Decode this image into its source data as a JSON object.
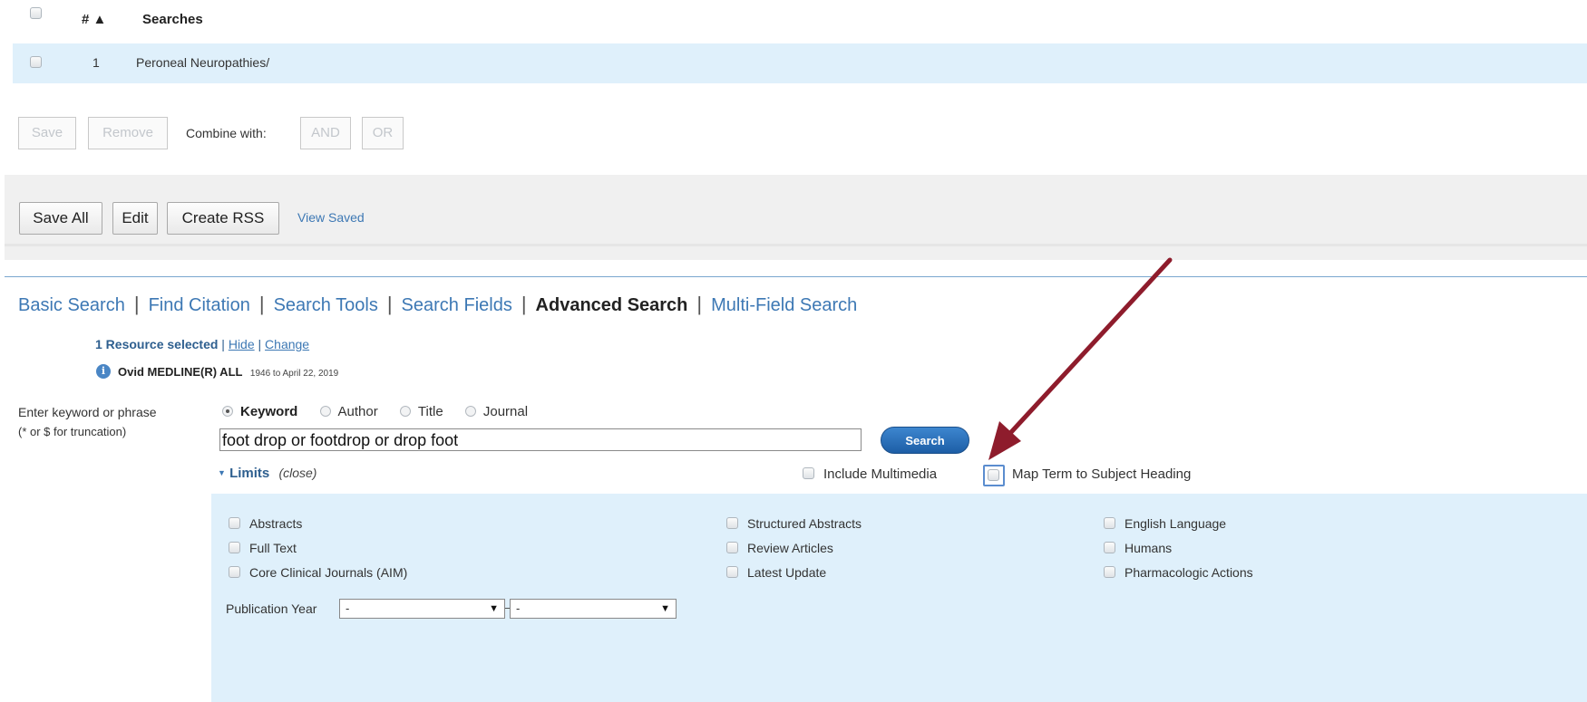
{
  "history": {
    "col_number": "# ▲",
    "col_searches": "Searches",
    "rows": [
      {
        "number": "1",
        "search": "Peroneal Neuropathies/"
      }
    ]
  },
  "actions": {
    "save": "Save",
    "remove": "Remove",
    "combine_label": "Combine with:",
    "and": "AND",
    "or": "OR"
  },
  "toolbar": {
    "save_all": "Save All",
    "edit": "Edit",
    "create_rss": "Create RSS",
    "view_saved": "View Saved"
  },
  "tabs": [
    {
      "label": "Basic Search",
      "active": false
    },
    {
      "label": "Find Citation",
      "active": false
    },
    {
      "label": "Search Tools",
      "active": false
    },
    {
      "label": "Search Fields",
      "active": false
    },
    {
      "label": "Advanced Search",
      "active": true
    },
    {
      "label": "Multi-Field Search",
      "active": false
    }
  ],
  "resource": {
    "selected": "1 Resource selected",
    "divider": "|",
    "hide": "Hide",
    "change": "Change",
    "db_name": "Ovid MEDLINE(R) ALL",
    "db_range": "1946 to April 22, 2019",
    "info_icon": "info-icon"
  },
  "search_form": {
    "prompt": "Enter keyword or phrase",
    "hint": "(* or $ for truncation)",
    "radio_options": [
      {
        "label": "Keyword",
        "checked": true
      },
      {
        "label": "Author",
        "checked": false
      },
      {
        "label": "Title",
        "checked": false
      },
      {
        "label": "Journal",
        "checked": false
      }
    ],
    "query": "foot drop or footdrop or drop foot",
    "search_button": "Search",
    "limits_label": "Limits",
    "limits_close": "(close)",
    "include_multimedia": "Include Multimedia",
    "map_term": "Map Term to Subject Heading"
  },
  "limits": {
    "col1": [
      "Abstracts",
      "Full Text",
      "Core Clinical Journals (AIM)"
    ],
    "col2": [
      "Structured Abstracts",
      "Review Articles",
      "Latest Update"
    ],
    "col3": [
      "English Language",
      "Humans",
      "Pharmacologic Actions"
    ],
    "pub_year_label": "Publication Year",
    "pub_year_from": "-",
    "pub_year_to": "-"
  },
  "colors": {
    "link": "#3d78b4",
    "row_highlight": "#dff0fb",
    "limits_bg": "#dff0fb",
    "search_button": "#2a6db8",
    "arrow": "#8e1c2c"
  }
}
